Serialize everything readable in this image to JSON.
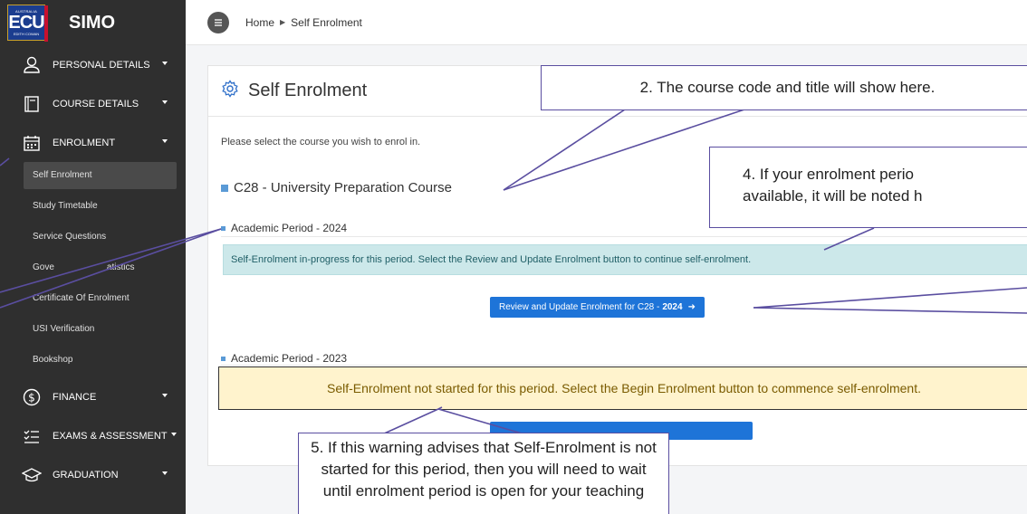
{
  "app": {
    "brand": "SIMO",
    "logo_text": "ECU",
    "logo_top": "AUSTRALIA",
    "logo_sub": "EDITH COWAN"
  },
  "sidebar": {
    "groups": [
      {
        "label": "PERSONAL DETAILS",
        "icon": "person-icon"
      },
      {
        "label": "COURSE DETAILS",
        "icon": "book-icon"
      },
      {
        "label": "ENROLMENT",
        "icon": "calendar-icon"
      }
    ],
    "enrolment_items": [
      "Self Enrolment",
      "Study Timetable",
      "Service Questions",
      "Gove",
      "atistics",
      "Certificate Of Enrolment",
      "USI Verification",
      "Bookshop"
    ],
    "lower_groups": [
      {
        "label": "FINANCE",
        "icon": "dollar-icon"
      },
      {
        "label": "EXAMS & ASSESSMENT",
        "icon": "checklist-icon"
      },
      {
        "label": "GRADUATION",
        "icon": "graduation-cap-icon"
      }
    ]
  },
  "header": {
    "home": "Home",
    "current": "Self Enrolment"
  },
  "main": {
    "title": "Self Enrolment",
    "intro": "Please select the course you wish to enrol in.",
    "course": "C28 - University Preparation Course",
    "period1": "Academic Period - 2024",
    "period1_alert": "Self-Enrolment in-progress for this period. Select the Review and Update Enrolment button to continue self-enrolment.",
    "period1_button": "Review and Update Enrolment for C28 - ",
    "period1_button_year": "2024",
    "period2": "Academic Period - 2023",
    "period2_alert": "Self-Enrolment not started for this period. Select the Begin Enrolment button to commence self-enrolment."
  },
  "callouts": {
    "c2": "2. The course code and title will show here.",
    "c4_line1": "4. If your enrolment perio",
    "c4_line2": "available, it will be noted h",
    "c5_line1": "5. If this warning advises that Self-Enrolment is not",
    "c5_line2": "started for this period,  then you will need to wait",
    "c5_line3": "until enrolment period is open for your teaching"
  },
  "colors": {
    "sidebar_bg": "#2f2f2f",
    "primary": "#1e74d8",
    "info_bg": "#cce8ea",
    "warn_bg": "#fff3cd",
    "callout_border": "#5a4ea0"
  }
}
